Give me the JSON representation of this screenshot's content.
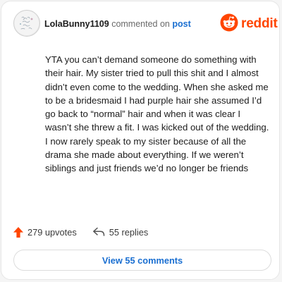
{
  "header": {
    "username": "LolaBunny1109",
    "commented_on": "commented on",
    "post_link": "post"
  },
  "brand": {
    "wordmark": "reddit",
    "icon": "reddit-snoo-icon",
    "color": "#ff4500"
  },
  "avatar": {
    "icon": "user-avatar",
    "lettering": [
      "Lovely",
      "little",
      "things"
    ]
  },
  "comment": {
    "text": "YTA you can’t demand someone do something with their hair. My sister tried to pull this shit and I almost didn’t even come to the wedding. When she asked me to be a bridesmaid I had purple hair she assumed I’d go back to “normal” hair and when it was clear I wasn’t she threw a fit. I was kicked out of the wedding. I now rarely speak to my sister because of all the drama she made about everything. If we weren’t siblings and just friends we’d no longer be friends"
  },
  "actions": {
    "upvotes": "279 upvotes",
    "upvote_icon": "upvote-arrow-icon",
    "upvote_color": "#ff4500",
    "replies": "55 replies",
    "reply_icon": "reply-arrow-icon"
  },
  "view_button": {
    "label": "View 55 comments",
    "color": "#1a6fd1"
  }
}
